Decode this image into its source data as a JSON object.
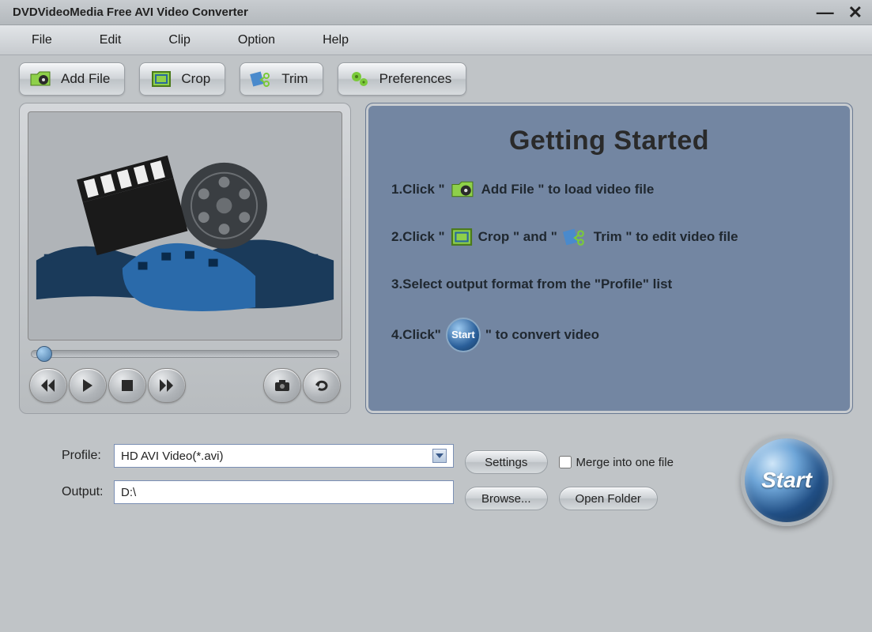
{
  "title": "DVDVideoMedia Free AVI Video Converter",
  "menu": {
    "file": "File",
    "edit": "Edit",
    "clip": "Clip",
    "option": "Option",
    "help": "Help"
  },
  "toolbar": {
    "addfile": "Add File",
    "crop": "Crop",
    "trim": "Trim",
    "preferences": "Preferences"
  },
  "guide": {
    "title": "Getting Started",
    "step1a": "1.Click \"",
    "step1b": "Add File \" to load video file",
    "step2a": "2.Click \"",
    "step2b": " Crop \" and \"",
    "step2c": " Trim \" to edit video file",
    "step3": "3.Select output format from the \"Profile\" list",
    "step4a": "4.Click\"",
    "step4b": "\" to convert video",
    "start_mini": "Start"
  },
  "bottom": {
    "profile_label": "Profile:",
    "profile_value": "HD AVI Video(*.avi)",
    "output_label": "Output:",
    "output_value": "D:\\",
    "settings": "Settings",
    "browse": "Browse...",
    "openfolder": "Open Folder",
    "merge": "Merge into one file",
    "start": "Start"
  }
}
